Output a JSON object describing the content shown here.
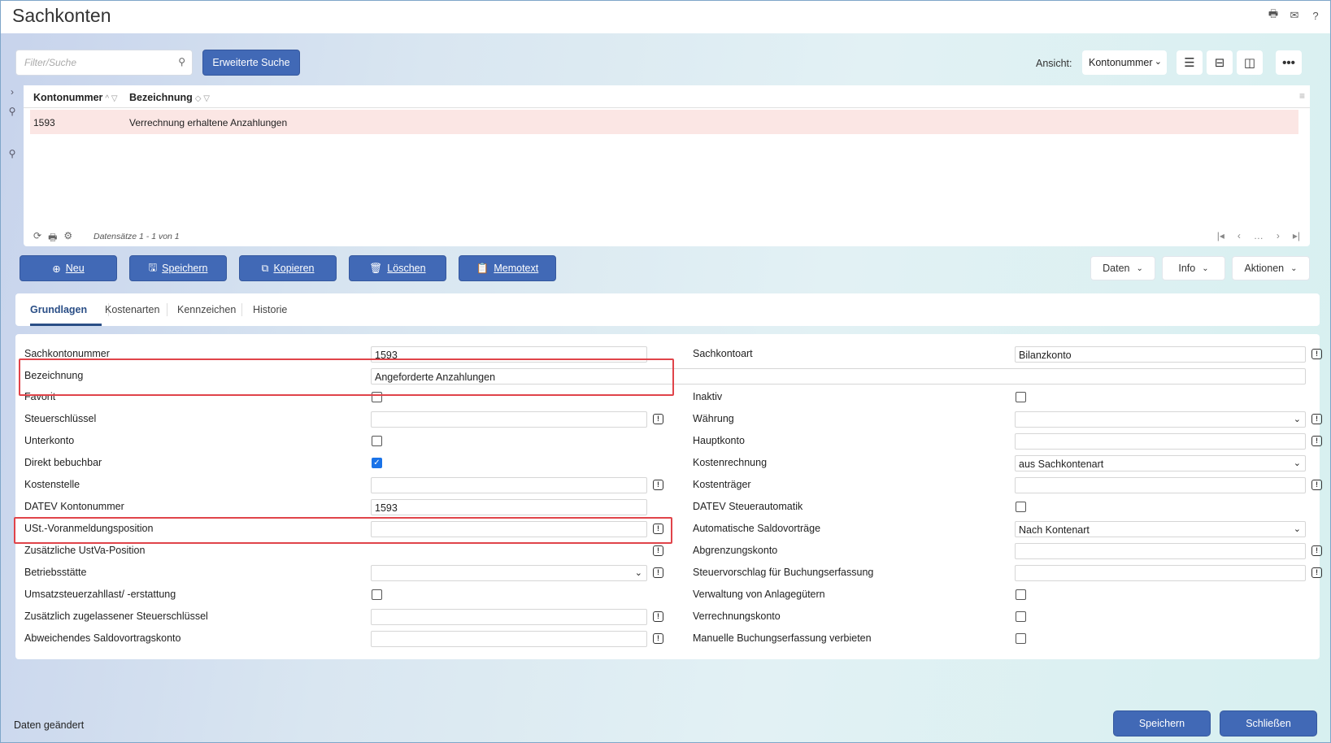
{
  "window": {
    "title": "Sachkonten"
  },
  "toolbar": {
    "search_placeholder": "Filter/Suche",
    "advanced_search": "Erweiterte Suche",
    "ansicht_label": "Ansicht:",
    "ansicht_value": "Kontonummer"
  },
  "grid": {
    "columns": [
      "Kontonummer",
      "Bezeichnung"
    ],
    "rows": [
      {
        "kontonummer": "1593",
        "bezeichnung": "Verrechnung erhaltene Anzahlungen"
      }
    ],
    "record_count": "Datensätze 1 - 1 von 1"
  },
  "actions": {
    "neu": "Neu",
    "speichern": "Speichern",
    "kopieren": "Kopieren",
    "loeschen": "Löschen",
    "memotext": "Memotext",
    "daten": "Daten",
    "info": "Info",
    "aktionen": "Aktionen"
  },
  "tabs": [
    "Grundlagen",
    "Kostenarten",
    "Kennzeichen",
    "Historie"
  ],
  "form": {
    "left": {
      "sachkontonummer": {
        "label": "Sachkontonummer",
        "value": "1593"
      },
      "bezeichnung": {
        "label": "Bezeichnung",
        "value": "Angeforderte Anzahlungen"
      },
      "favorit": {
        "label": "Favorit"
      },
      "steuerschluessel": {
        "label": "Steuerschlüssel"
      },
      "unterkonto": {
        "label": "Unterkonto"
      },
      "direkt_bebuchbar": {
        "label": "Direkt bebuchbar"
      },
      "kostenstelle": {
        "label": "Kostenstelle"
      },
      "datev_kontonummer": {
        "label": "DATEV Kontonummer",
        "value": "1593"
      },
      "ust_voranmeldungsposition": {
        "label": "USt.-Voranmeldungsposition"
      },
      "zusaetzliche_ustva": {
        "label": "Zusätzliche UstVa-Position"
      },
      "betriebsstaette": {
        "label": "Betriebsstätte"
      },
      "umsatzsteuerzahllast": {
        "label": "Umsatzsteuerzahllast/ -erstattung"
      },
      "zusaetzlich_steuerschluessel": {
        "label": "Zusätzlich zugelassener Steuerschlüssel"
      },
      "abweichendes_saldovortragskonto": {
        "label": "Abweichendes Saldovortragskonto"
      }
    },
    "right": {
      "sachkontoart": {
        "label": "Sachkontoart",
        "value": "Bilanzkonto"
      },
      "inaktiv": {
        "label": "Inaktiv"
      },
      "waehrung": {
        "label": "Währung"
      },
      "hauptkonto": {
        "label": "Hauptkonto"
      },
      "kostenrechnung": {
        "label": "Kostenrechnung",
        "value": "aus Sachkontenart"
      },
      "kostentraeger": {
        "label": "Kostenträger"
      },
      "datev_steuerautomatik": {
        "label": "DATEV Steuerautomatik"
      },
      "automatische_saldovortraege": {
        "label": "Automatische Saldovorträge",
        "value": "Nach Kontenart"
      },
      "abgrenzungskonto": {
        "label": "Abgrenzungskonto"
      },
      "steuervorschlag": {
        "label": "Steuervorschlag für Buchungserfassung"
      },
      "verwaltung_anlagegueter": {
        "label": "Verwaltung von Anlagegütern"
      },
      "verrechnungskonto": {
        "label": "Verrechnungskonto"
      },
      "manuelle_buchungserfassung": {
        "label": "Manuelle Buchungserfassung verbieten"
      }
    }
  },
  "footer": {
    "status": "Daten geändert",
    "save": "Speichern",
    "close": "Schließen"
  },
  "colors": {
    "primary": "#4169b6",
    "highlight_row": "#fbe6e4",
    "annotation": "#e0444a"
  }
}
